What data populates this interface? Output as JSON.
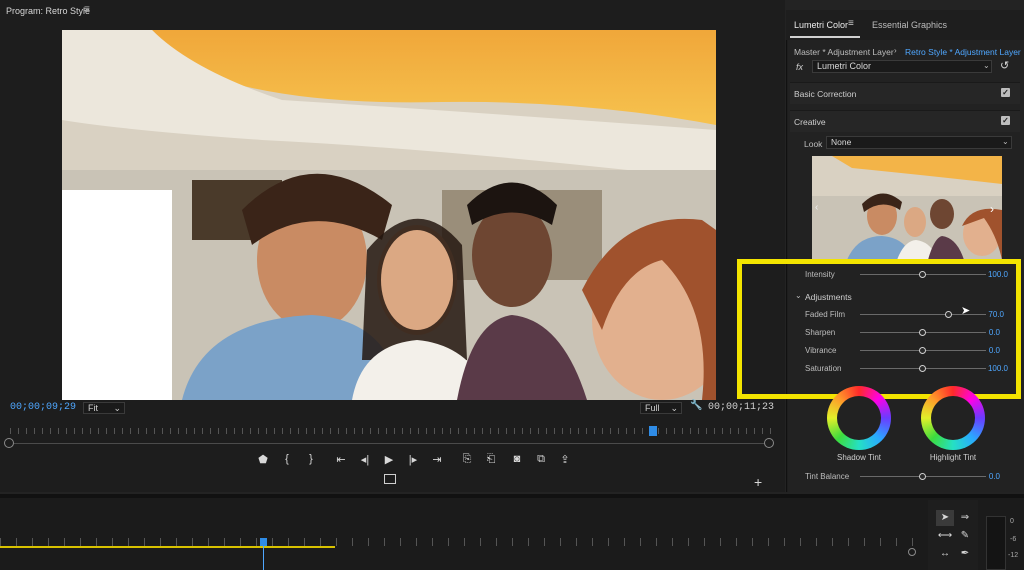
{
  "program": {
    "title": "Program: Retro Style",
    "menu_icon": "hamburger-icon",
    "timecode_current": "00;00;09;29",
    "timecode_duration": "00;00;11;23",
    "zoom_select": "Fit",
    "resolution_select": "Full",
    "transport": {
      "marker": "marker-icon",
      "mark_in": "{",
      "mark_out": "}",
      "go_to_in": "go-to-in-icon",
      "step_back": "step-back-icon",
      "play": "play-icon",
      "step_forward": "step-forward-icon",
      "go_to_out": "go-to-out-icon",
      "lift": "lift-icon",
      "extract": "extract-icon",
      "export_frame": "camera-icon",
      "comparison": "comparison-view-icon",
      "share": "share-icon"
    }
  },
  "lumetri": {
    "tabs": [
      "Lumetri Color",
      "Essential Graphics"
    ],
    "master_label": "Master * Adjustment Layer",
    "clip_label": "Retro Style * Adjustment Layer",
    "fx_label": "fx",
    "effect_name": "Lumetri Color",
    "sections": {
      "basic_correction": "Basic Correction",
      "creative": "Creative"
    },
    "look_label": "Look",
    "look_value": "None",
    "intensity": {
      "label": "Intensity",
      "value": "100.0",
      "position": 0.5
    },
    "adjustments_label": "Adjustments",
    "adjustments": [
      {
        "label": "Faded Film",
        "value": "70.0",
        "position": 0.7
      },
      {
        "label": "Sharpen",
        "value": "0.0",
        "position": 0.5
      },
      {
        "label": "Vibrance",
        "value": "0.0",
        "position": 0.5
      },
      {
        "label": "Saturation",
        "value": "100.0",
        "position": 0.5
      }
    ],
    "wheels": [
      {
        "label": "Shadow Tint"
      },
      {
        "label": "Highlight Tint"
      }
    ],
    "tint_balance": {
      "label": "Tint Balance",
      "value": "0.0",
      "position": 0.5
    }
  },
  "timeline": {
    "meter_labels": [
      "0",
      "-6",
      "-12"
    ]
  },
  "colors": {
    "accent_blue": "#4fa7ff",
    "highlight_yellow": "#f3e400",
    "panel_bg": "#222222"
  }
}
